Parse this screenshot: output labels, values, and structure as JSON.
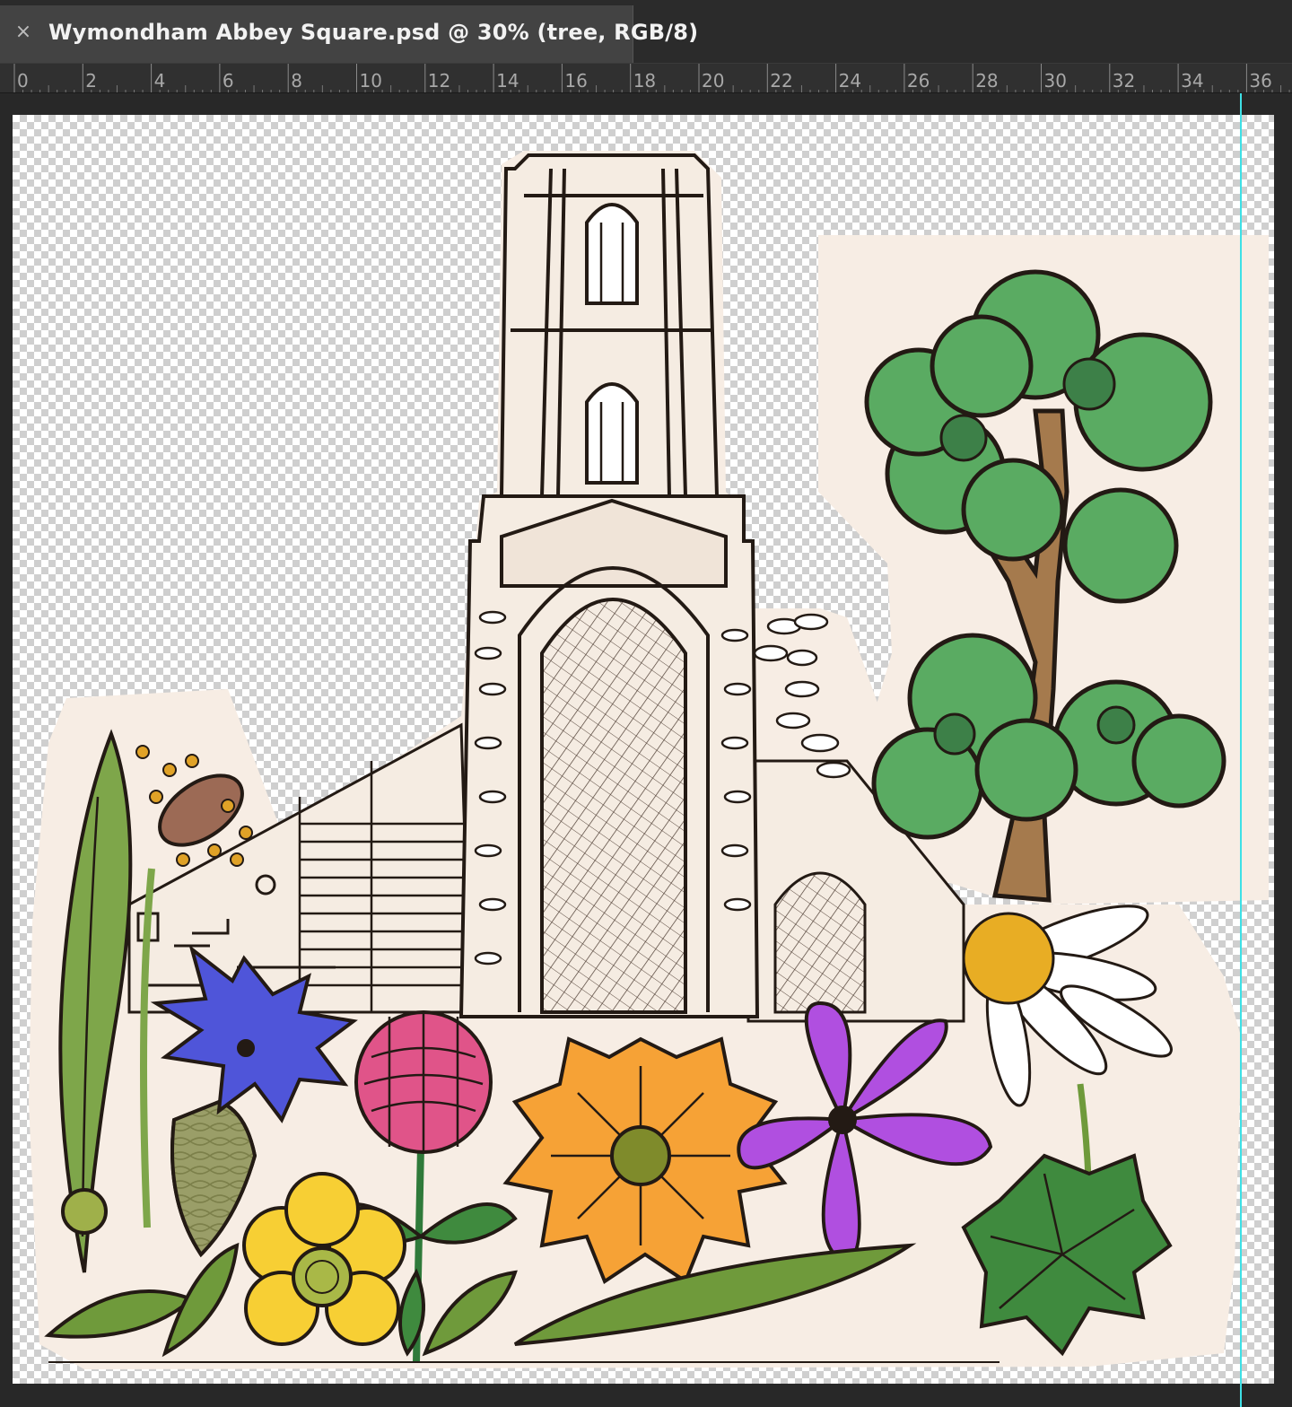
{
  "document": {
    "tab_title": "Wymondham Abbey Square.psd @ 30% (tree, RGB/8)",
    "close_label": "×"
  },
  "ruler": {
    "labels": [
      "0",
      "2",
      "4",
      "6",
      "8",
      "10",
      "12",
      "14",
      "16",
      "18",
      "20",
      "22",
      "24",
      "26",
      "28",
      "30",
      "32",
      "34",
      "36"
    ]
  },
  "colors": {
    "paper": "#f7ede4",
    "ink": "#231a14",
    "tree_green": "#5aab62",
    "tree_dark": "#3d8048",
    "trunk": "#a57a4d",
    "guide": "#3ee0e6",
    "cornflower": "#4f55d9",
    "clover": "#e05489",
    "buttercup": "#f7cf34",
    "marigold": "#f6a236",
    "mallow": "#b04fe0",
    "leaf": "#6f9a3b",
    "leaf_dark": "#3f8a3e"
  },
  "icons": {
    "close": "close-icon"
  }
}
